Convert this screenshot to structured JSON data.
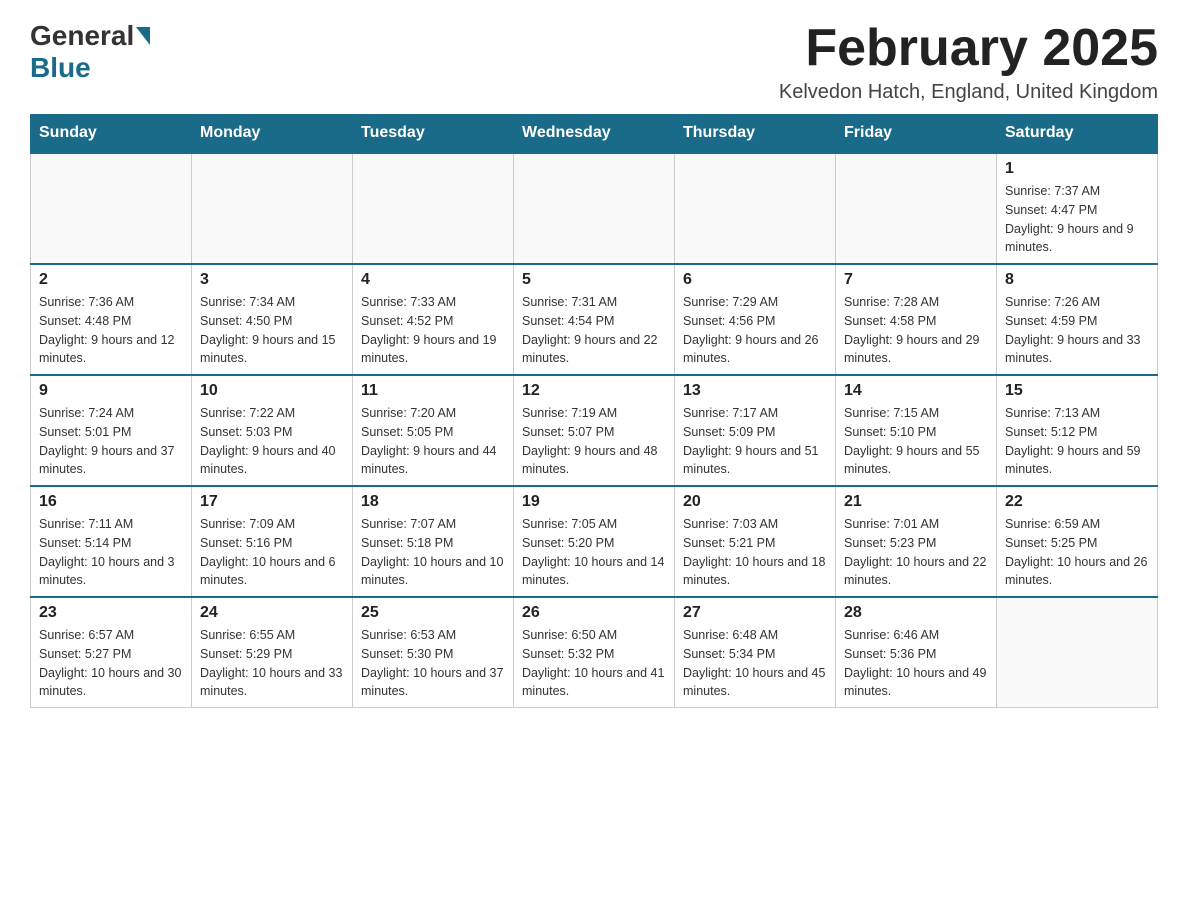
{
  "header": {
    "logo_general": "General",
    "logo_blue": "Blue",
    "month_title": "February 2025",
    "location": "Kelvedon Hatch, England, United Kingdom"
  },
  "days_of_week": [
    "Sunday",
    "Monday",
    "Tuesday",
    "Wednesday",
    "Thursday",
    "Friday",
    "Saturday"
  ],
  "weeks": [
    [
      {
        "day": "",
        "info": ""
      },
      {
        "day": "",
        "info": ""
      },
      {
        "day": "",
        "info": ""
      },
      {
        "day": "",
        "info": ""
      },
      {
        "day": "",
        "info": ""
      },
      {
        "day": "",
        "info": ""
      },
      {
        "day": "1",
        "info": "Sunrise: 7:37 AM\nSunset: 4:47 PM\nDaylight: 9 hours and 9 minutes."
      }
    ],
    [
      {
        "day": "2",
        "info": "Sunrise: 7:36 AM\nSunset: 4:48 PM\nDaylight: 9 hours and 12 minutes."
      },
      {
        "day": "3",
        "info": "Sunrise: 7:34 AM\nSunset: 4:50 PM\nDaylight: 9 hours and 15 minutes."
      },
      {
        "day": "4",
        "info": "Sunrise: 7:33 AM\nSunset: 4:52 PM\nDaylight: 9 hours and 19 minutes."
      },
      {
        "day": "5",
        "info": "Sunrise: 7:31 AM\nSunset: 4:54 PM\nDaylight: 9 hours and 22 minutes."
      },
      {
        "day": "6",
        "info": "Sunrise: 7:29 AM\nSunset: 4:56 PM\nDaylight: 9 hours and 26 minutes."
      },
      {
        "day": "7",
        "info": "Sunrise: 7:28 AM\nSunset: 4:58 PM\nDaylight: 9 hours and 29 minutes."
      },
      {
        "day": "8",
        "info": "Sunrise: 7:26 AM\nSunset: 4:59 PM\nDaylight: 9 hours and 33 minutes."
      }
    ],
    [
      {
        "day": "9",
        "info": "Sunrise: 7:24 AM\nSunset: 5:01 PM\nDaylight: 9 hours and 37 minutes."
      },
      {
        "day": "10",
        "info": "Sunrise: 7:22 AM\nSunset: 5:03 PM\nDaylight: 9 hours and 40 minutes."
      },
      {
        "day": "11",
        "info": "Sunrise: 7:20 AM\nSunset: 5:05 PM\nDaylight: 9 hours and 44 minutes."
      },
      {
        "day": "12",
        "info": "Sunrise: 7:19 AM\nSunset: 5:07 PM\nDaylight: 9 hours and 48 minutes."
      },
      {
        "day": "13",
        "info": "Sunrise: 7:17 AM\nSunset: 5:09 PM\nDaylight: 9 hours and 51 minutes."
      },
      {
        "day": "14",
        "info": "Sunrise: 7:15 AM\nSunset: 5:10 PM\nDaylight: 9 hours and 55 minutes."
      },
      {
        "day": "15",
        "info": "Sunrise: 7:13 AM\nSunset: 5:12 PM\nDaylight: 9 hours and 59 minutes."
      }
    ],
    [
      {
        "day": "16",
        "info": "Sunrise: 7:11 AM\nSunset: 5:14 PM\nDaylight: 10 hours and 3 minutes."
      },
      {
        "day": "17",
        "info": "Sunrise: 7:09 AM\nSunset: 5:16 PM\nDaylight: 10 hours and 6 minutes."
      },
      {
        "day": "18",
        "info": "Sunrise: 7:07 AM\nSunset: 5:18 PM\nDaylight: 10 hours and 10 minutes."
      },
      {
        "day": "19",
        "info": "Sunrise: 7:05 AM\nSunset: 5:20 PM\nDaylight: 10 hours and 14 minutes."
      },
      {
        "day": "20",
        "info": "Sunrise: 7:03 AM\nSunset: 5:21 PM\nDaylight: 10 hours and 18 minutes."
      },
      {
        "day": "21",
        "info": "Sunrise: 7:01 AM\nSunset: 5:23 PM\nDaylight: 10 hours and 22 minutes."
      },
      {
        "day": "22",
        "info": "Sunrise: 6:59 AM\nSunset: 5:25 PM\nDaylight: 10 hours and 26 minutes."
      }
    ],
    [
      {
        "day": "23",
        "info": "Sunrise: 6:57 AM\nSunset: 5:27 PM\nDaylight: 10 hours and 30 minutes."
      },
      {
        "day": "24",
        "info": "Sunrise: 6:55 AM\nSunset: 5:29 PM\nDaylight: 10 hours and 33 minutes."
      },
      {
        "day": "25",
        "info": "Sunrise: 6:53 AM\nSunset: 5:30 PM\nDaylight: 10 hours and 37 minutes."
      },
      {
        "day": "26",
        "info": "Sunrise: 6:50 AM\nSunset: 5:32 PM\nDaylight: 10 hours and 41 minutes."
      },
      {
        "day": "27",
        "info": "Sunrise: 6:48 AM\nSunset: 5:34 PM\nDaylight: 10 hours and 45 minutes."
      },
      {
        "day": "28",
        "info": "Sunrise: 6:46 AM\nSunset: 5:36 PM\nDaylight: 10 hours and 49 minutes."
      },
      {
        "day": "",
        "info": ""
      }
    ]
  ]
}
